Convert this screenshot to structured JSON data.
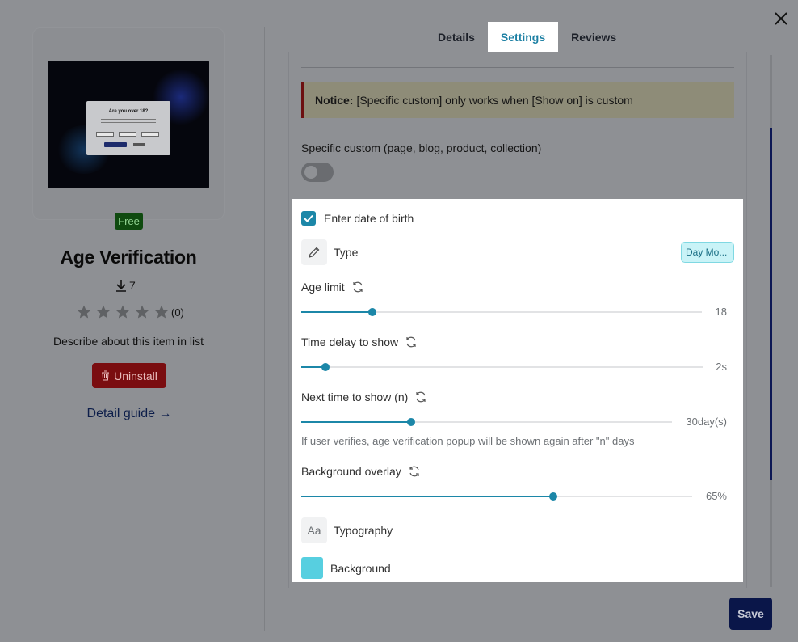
{
  "app": {
    "title": "Age Verification",
    "badge": "Free",
    "downloads": "7",
    "rating_count": "(0)",
    "rating_stars": 0,
    "description": "Describe about this item in list",
    "uninstall_label": "Uninstall",
    "guide_label": "Detail guide →",
    "preview": {
      "modal_title": "Are you over 18?"
    }
  },
  "tabs": [
    {
      "label": "Details",
      "active": false
    },
    {
      "label": "Settings",
      "active": true
    },
    {
      "label": "Reviews",
      "active": false
    }
  ],
  "settings": {
    "notice_bold": "Notice:",
    "notice_text": "[Specific custom] only works when [Show on] is custom",
    "specific_label": "Specific custom (page, blog, product, collection)",
    "specific_enabled": false,
    "dob_label": "Enter date of birth",
    "dob_checked": true,
    "type_label": "Type",
    "type_value": "Day Mo...",
    "age_limit": {
      "label": "Age limit",
      "value": "18",
      "fill_fraction": 0.177
    },
    "time_delay": {
      "label": "Time delay to show",
      "value": "2s",
      "fill_fraction": 0.06
    },
    "next_time": {
      "label": "Next time to show (n)",
      "value": "30day(s)",
      "fill_fraction": 0.297,
      "help": "If user verifies, age verification popup will be shown again after \"n\" days"
    },
    "overlay": {
      "label": "Background overlay",
      "value": "65%",
      "fill_fraction": 0.645
    },
    "typography_label": "Typography",
    "typography_icon_text": "Aa",
    "background_label": "Background",
    "background_color": "#57cfe0"
  },
  "actions": {
    "save_label": "Save"
  },
  "colors": {
    "accent": "#1c87a8",
    "danger": "#7a0d10",
    "primary_dark": "#0a1649"
  }
}
